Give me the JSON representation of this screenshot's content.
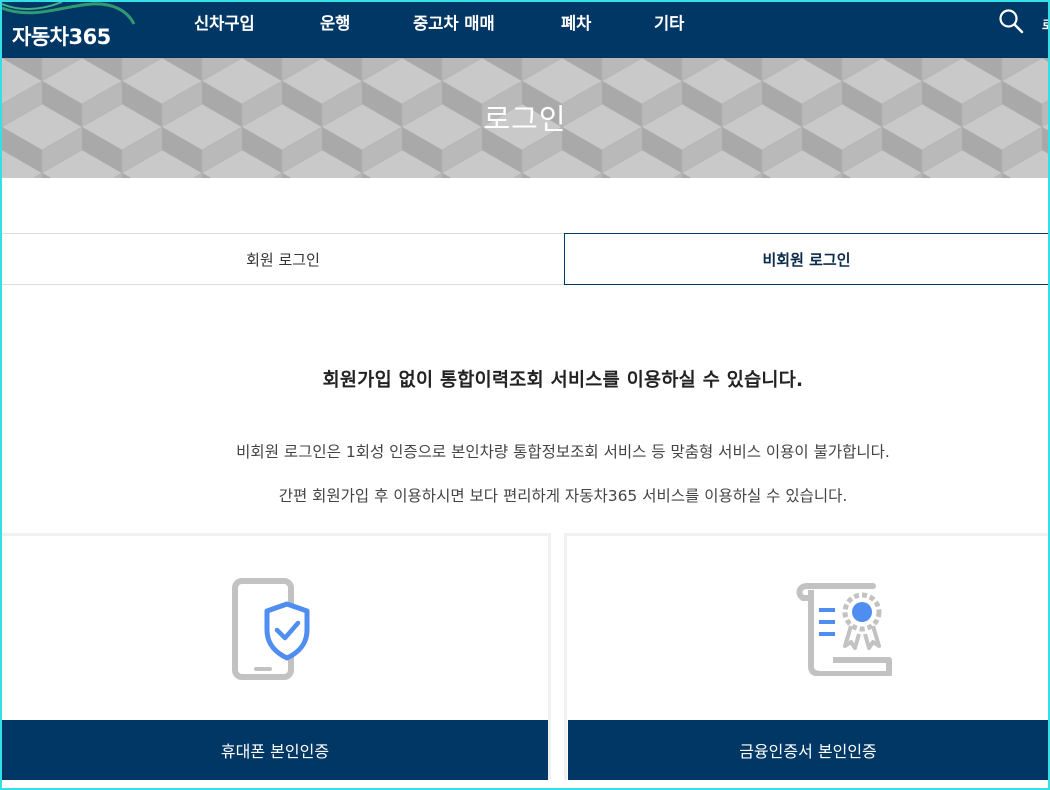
{
  "header": {
    "logo": "자동차365",
    "nav": [
      "신차구입",
      "운행",
      "중고차 매매",
      "폐차",
      "기타"
    ],
    "edge_glyph": "로"
  },
  "banner": {
    "title": "로그인"
  },
  "tabs": {
    "member": "회원 로그인",
    "guest": "비회원 로그인",
    "active": "guest"
  },
  "content": {
    "headline": "회원가입 없이 통합이력조회 서비스를 이용하실 수 있습니다.",
    "desc1": "비회원 로그인은 1회성 인증으로 본인차량 통합정보조회 서비스 등 맞춤형 서비스 이용이 불가합니다.",
    "desc2": "간편 회원가입 후 이용하시면 보다 편리하게 자동차365 서비스를 이용하실 수 있습니다."
  },
  "cards": {
    "phone": {
      "label": "휴대폰 본인인증",
      "icon": "phone-shield-icon"
    },
    "cert": {
      "label": "금융인증서 본인인증",
      "icon": "certificate-icon"
    }
  },
  "colors": {
    "primary": "#003764",
    "accent": "#4f8ef0",
    "icon_gray": "#c2c2c2",
    "frame": "#34e0e6"
  }
}
